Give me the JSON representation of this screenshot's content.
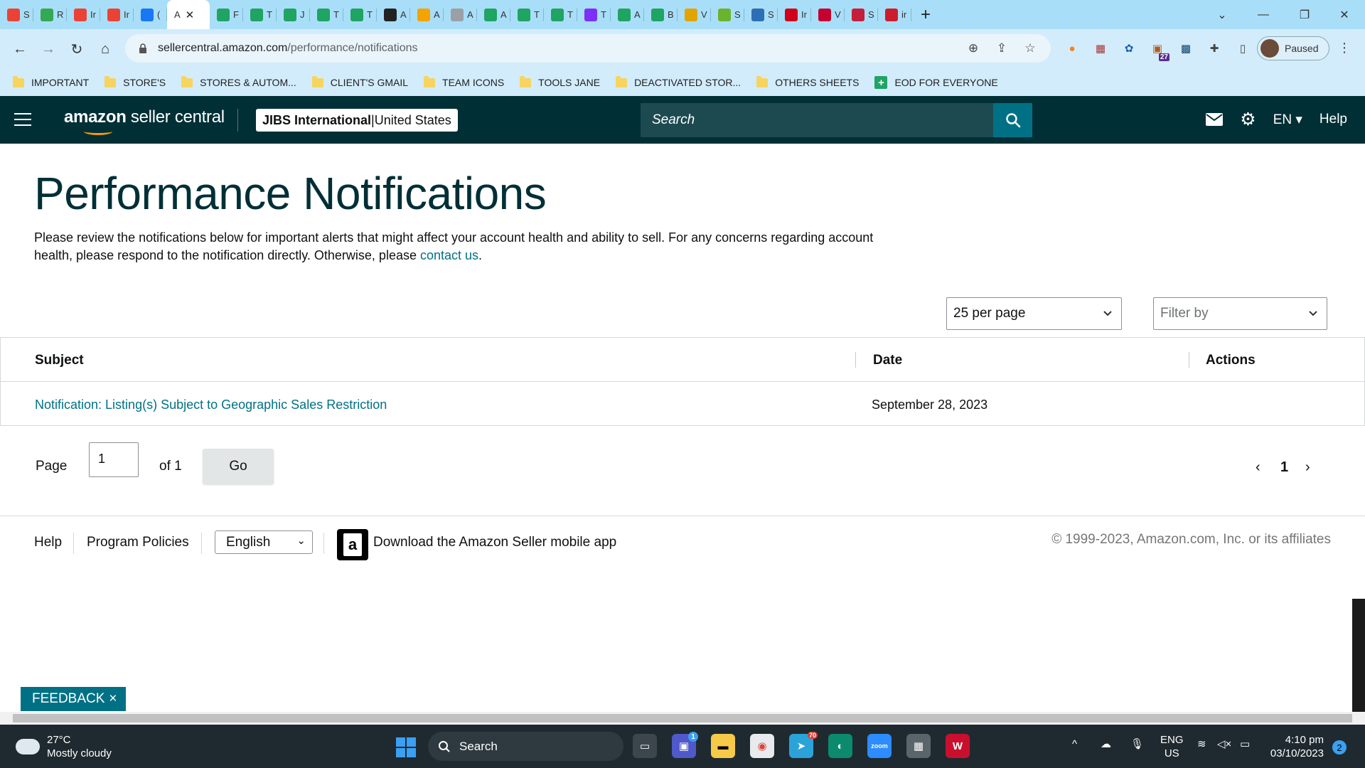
{
  "browser": {
    "tabs": [
      {
        "icon": "gmail-icon",
        "label": "S",
        "color": "#ea4335"
      },
      {
        "icon": "drive-icon",
        "label": "R",
        "color": "#34a853"
      },
      {
        "icon": "gmail-icon",
        "label": "Ir",
        "color": "#ea4335"
      },
      {
        "icon": "gmail-icon",
        "label": "Ir",
        "color": "#ea4335"
      },
      {
        "icon": "facebook-icon",
        "label": "(",
        "color": "#1877f2"
      },
      {
        "icon": "amazon-icon",
        "label": "A",
        "color": "#ffffff",
        "active": true
      },
      {
        "icon": "sheets-icon",
        "label": "F",
        "color": "#1fa463"
      },
      {
        "icon": "sheets-icon",
        "label": "T",
        "color": "#1fa463"
      },
      {
        "icon": "sheets-icon",
        "label": "J",
        "color": "#1fa463"
      },
      {
        "icon": "sheets-icon",
        "label": "T",
        "color": "#1fa463"
      },
      {
        "icon": "sheets-icon",
        "label": "T",
        "color": "#1fa463"
      },
      {
        "icon": "c-logo-icon",
        "label": "A",
        "color": "#222222"
      },
      {
        "icon": "pen-icon",
        "label": "A",
        "color": "#f4a300"
      },
      {
        "icon": "globe-icon",
        "label": "A",
        "color": "#9aa0a6"
      },
      {
        "icon": "sheets-icon",
        "label": "A",
        "color": "#1fa463"
      },
      {
        "icon": "sheets-icon",
        "label": "T",
        "color": "#1fa463"
      },
      {
        "icon": "sheets-icon",
        "label": "T",
        "color": "#1fa463"
      },
      {
        "icon": "chat-icon",
        "label": "T",
        "color": "#7b2ff7"
      },
      {
        "icon": "sheets-icon",
        "label": "A",
        "color": "#1fa463"
      },
      {
        "icon": "sheets-icon",
        "label": "B",
        "color": "#1fa463"
      },
      {
        "icon": "colorful-icon",
        "label": "V",
        "color": "#e2a400"
      },
      {
        "icon": "w-green-icon",
        "label": "S",
        "color": "#6ab42d"
      },
      {
        "icon": "shop-icon",
        "label": "S",
        "color": "#2c6fb5"
      },
      {
        "icon": "tsc-icon",
        "label": "Ir",
        "color": "#d0021b"
      },
      {
        "icon": "ww-icon",
        "label": "V",
        "color": "#c3002f"
      },
      {
        "icon": "store-icon",
        "label": "S",
        "color": "#c41e3a"
      },
      {
        "icon": "pin-icon",
        "label": "ir",
        "color": "#cc1c2c"
      }
    ],
    "url_host": "sellercentral.amazon.com",
    "url_path": "/performance/notifications",
    "profile_status": "Paused",
    "ext_badge": "27",
    "bookmarks": [
      {
        "label": "IMPORTANT",
        "type": "folder"
      },
      {
        "label": "STORE'S",
        "type": "folder"
      },
      {
        "label": "STORES & AUTOM...",
        "type": "folder"
      },
      {
        "label": "CLIENT'S GMAIL",
        "type": "folder"
      },
      {
        "label": "TEAM ICONS",
        "type": "folder"
      },
      {
        "label": "TOOLS JANE",
        "type": "folder"
      },
      {
        "label": "DEACTIVATED STOR...",
        "type": "folder"
      },
      {
        "label": "OTHERS SHEETS",
        "type": "folder"
      },
      {
        "label": "EOD FOR EVERYONE",
        "type": "sheet"
      }
    ]
  },
  "header": {
    "logo_bold": "amazon",
    "logo_rest": " seller central",
    "account_name": "JIBS International",
    "account_sep": " | ",
    "account_region": "United States",
    "search_placeholder": "Search",
    "language": "EN",
    "help": "Help",
    "colors": {
      "bar": "#002f36",
      "search_button": "#007185",
      "accent": "#ff9900"
    }
  },
  "main": {
    "title": "Performance Notifications",
    "intro_text": "Please review the notifications below for important alerts that might affect your account health and ability to sell. For any concerns regarding account health, please respond to the notification directly. Otherwise, please ",
    "intro_link": "contact us",
    "intro_end": ".",
    "per_page": "25 per page",
    "filter_placeholder": "Filter by",
    "table": {
      "columns": [
        "Subject",
        "Date",
        "Actions"
      ],
      "rows": [
        {
          "subject": "Notification: Listing(s) Subject to Geographic Sales Restriction",
          "date": "September 28, 2023",
          "actions": ""
        }
      ]
    },
    "pagination": {
      "page_label": "Page",
      "page_value": "1",
      "of_label": "of 1",
      "go_label": "Go",
      "current_page": "1"
    }
  },
  "footer": {
    "help": "Help",
    "policies": "Program Policies",
    "language": "English",
    "app_text": "Download the Amazon Seller mobile app",
    "copyright": "© 1999-2023, Amazon.com, Inc. or its affiliates"
  },
  "feedback": {
    "label": "FEEDBACK",
    "close": "×"
  },
  "taskbar": {
    "temp": "27°C",
    "weather": "Mostly cloudy",
    "search": "Search",
    "lang_top": "ENG",
    "lang_bottom": "US",
    "time": "4:10 pm",
    "date": "03/10/2023",
    "notifications": "2",
    "teams_badge": "1",
    "telegram_badge": "70"
  }
}
